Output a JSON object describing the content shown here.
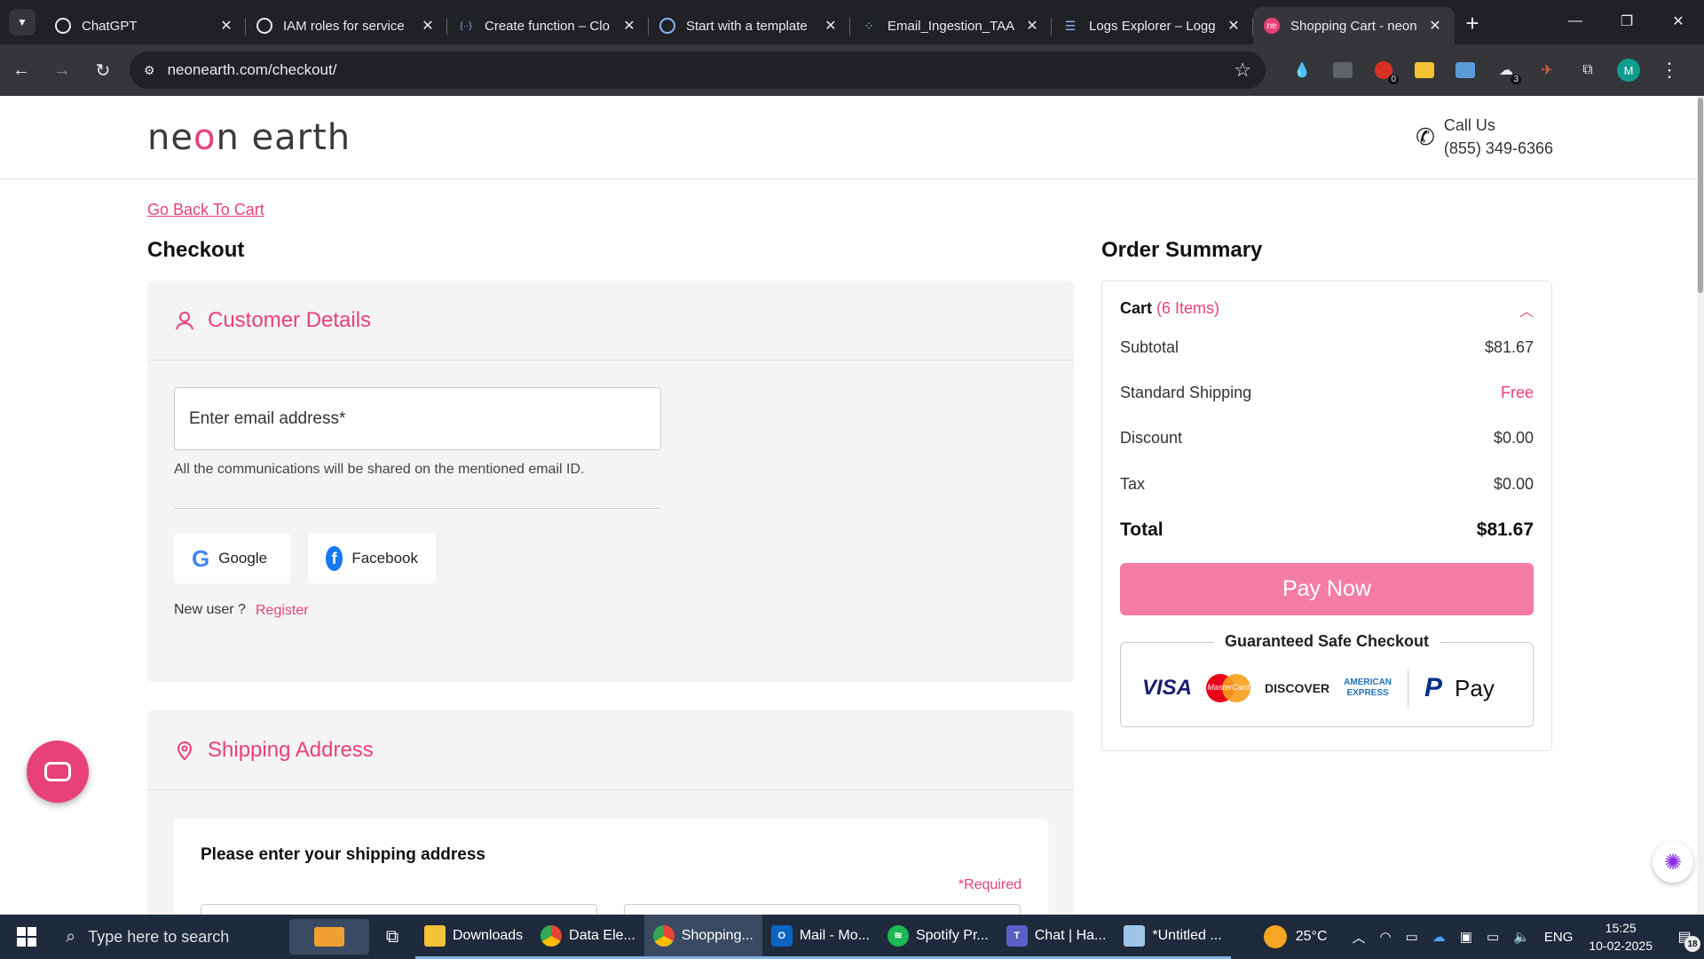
{
  "browser": {
    "tabs": [
      {
        "title": "ChatGPT",
        "favicon": "chatgpt-icon"
      },
      {
        "title": "IAM roles for service",
        "favicon": "chatgpt-icon"
      },
      {
        "title": "Create function – Clo",
        "favicon": "code-icon"
      },
      {
        "title": "Start with a template",
        "favicon": "search-icon"
      },
      {
        "title": "Email_Ingestion_TAA",
        "favicon": "nodes-icon"
      },
      {
        "title": "Logs Explorer – Logg",
        "favicon": "list-icon"
      },
      {
        "title": "Shopping Cart - neon",
        "favicon": "neonearth-icon"
      }
    ],
    "active_tab": 6,
    "url": "neonearth.com/checkout/",
    "profile_initial": "M",
    "extension_badges": [
      "0",
      "3"
    ]
  },
  "site": {
    "logo_left": "ne",
    "logo_o": "o",
    "logo_right": "n earth",
    "call_label": "Call Us",
    "phone": "(855) 349-6366",
    "back_link": "Go Back To Cart",
    "checkout_heading": "Checkout",
    "order_summary_heading": "Order Summary",
    "accent_color": "#e8407a"
  },
  "customer": {
    "title": "Customer Details",
    "email_placeholder": "Enter email address*",
    "email_note": "All the communications will be shared on the mentioned email ID.",
    "google_label": "Google",
    "facebook_label": "Facebook",
    "new_user": "New user ?",
    "register": "Register"
  },
  "shipping": {
    "title": "Shipping Address",
    "prompt": "Please enter your shipping address",
    "required": "*Required"
  },
  "summary": {
    "cart_label": "Cart",
    "cart_count": "(6 Items)",
    "rows": [
      {
        "label": "Subtotal",
        "value": "$81.67"
      },
      {
        "label": "Standard Shipping",
        "value": "Free"
      },
      {
        "label": "Discount",
        "value": "$0.00"
      },
      {
        "label": "Tax",
        "value": "$0.00"
      }
    ],
    "total_label": "Total",
    "total_value": "$81.67",
    "pay_button": "Pay Now",
    "safe_checkout": "Guaranteed Safe Checkout",
    "payment_logos": {
      "visa": "VISA",
      "mastercard": "MasterCard",
      "discover": "DISCOVER",
      "amex_line1": "AMERICAN",
      "amex_line2": "EXPRESS",
      "paypal": "P",
      "applepay": " Pay"
    }
  },
  "taskbar": {
    "search_placeholder": "Type here to search",
    "apps": [
      {
        "label": "Downloads",
        "icon": "folder-icon"
      },
      {
        "label": "Data Ele...",
        "icon": "chrome-icon"
      },
      {
        "label": "Shopping...",
        "icon": "chrome-icon"
      },
      {
        "label": "Mail - Mo...",
        "icon": "outlook-icon"
      },
      {
        "label": "Spotify Pr...",
        "icon": "spotify-icon"
      },
      {
        "label": "Chat | Ha...",
        "icon": "teams-icon"
      },
      {
        "label": "*Untitled ...",
        "icon": "notepad-icon"
      }
    ],
    "weather": "25°C",
    "weather_badge": "1",
    "language": "ENG",
    "time": "15:25",
    "date": "10-02-2025",
    "notifications": "18"
  }
}
